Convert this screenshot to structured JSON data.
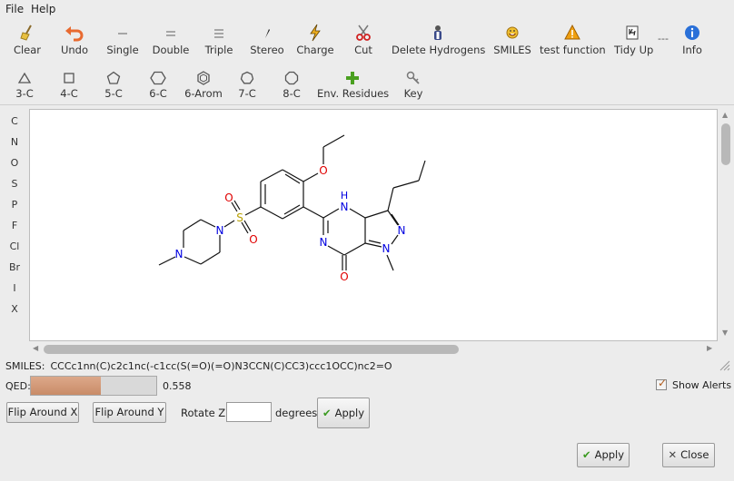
{
  "menu": {
    "file": "File",
    "help": "Help"
  },
  "toolbar1": [
    {
      "label": "Clear",
      "icon": "broom-icon"
    },
    {
      "label": "Undo",
      "icon": "undo-icon"
    },
    {
      "label": "Single",
      "icon": "single-bond-icon"
    },
    {
      "label": "Double",
      "icon": "double-bond-icon"
    },
    {
      "label": "Triple",
      "icon": "triple-bond-icon"
    },
    {
      "label": "Stereo",
      "icon": "stereo-bond-icon"
    },
    {
      "label": "Charge",
      "icon": "charge-icon"
    },
    {
      "label": "Cut",
      "icon": "scissors-icon"
    },
    {
      "label": "Delete Hydrogens",
      "icon": "delete-hydrogens-icon"
    },
    {
      "label": "SMILES",
      "icon": "smiles-icon"
    },
    {
      "label": "test function",
      "icon": "warning-icon"
    },
    {
      "label": "Tidy Up",
      "icon": "tidy-up-icon"
    },
    {
      "label": "Info",
      "icon": "info-icon"
    }
  ],
  "toolbar1_separator": "---",
  "toolbar2": [
    {
      "label": "3-C",
      "icon": "triangle-icon"
    },
    {
      "label": "4-C",
      "icon": "square-icon"
    },
    {
      "label": "5-C",
      "icon": "pentagon-icon"
    },
    {
      "label": "6-C",
      "icon": "hexagon-icon"
    },
    {
      "label": "6-Arom",
      "icon": "aromatic-hexagon-icon"
    },
    {
      "label": "7-C",
      "icon": "heptagon-icon"
    },
    {
      "label": "8-C",
      "icon": "octagon-icon"
    },
    {
      "label": "Env. Residues",
      "icon": "plus-icon"
    },
    {
      "label": "Key",
      "icon": "key-icon"
    }
  ],
  "elements": [
    "C",
    "N",
    "O",
    "S",
    "P",
    "F",
    "Cl",
    "Br",
    "I",
    "X"
  ],
  "molecule": {
    "atoms": {
      "O": "O",
      "N": "N",
      "H": "H",
      "S": "S"
    }
  },
  "smiles": {
    "label": "SMILES:",
    "value": "CCCc1nn(C)c2c1nc(-c1cc(S(=O)(=O)N3CCN(C)CC3)ccc1OCC)nc2=O"
  },
  "qed": {
    "label": "QED:",
    "value": "0.558",
    "fraction": 0.558
  },
  "show_alerts": {
    "label": "Show Alerts",
    "checked": true
  },
  "transform": {
    "flip_x": "Flip Around X",
    "flip_y": "Flip Around Y",
    "rotate_label": "Rotate Z",
    "rotate_value": "",
    "degrees_label": "degrees",
    "apply_label": "Apply"
  },
  "dialog": {
    "apply_label": "Apply",
    "close_label": "Close"
  },
  "colors": {
    "accent": "#c98c68",
    "oxygen": "#e00000",
    "nitrogen": "#0000e0",
    "sulfur": "#b8a000"
  }
}
